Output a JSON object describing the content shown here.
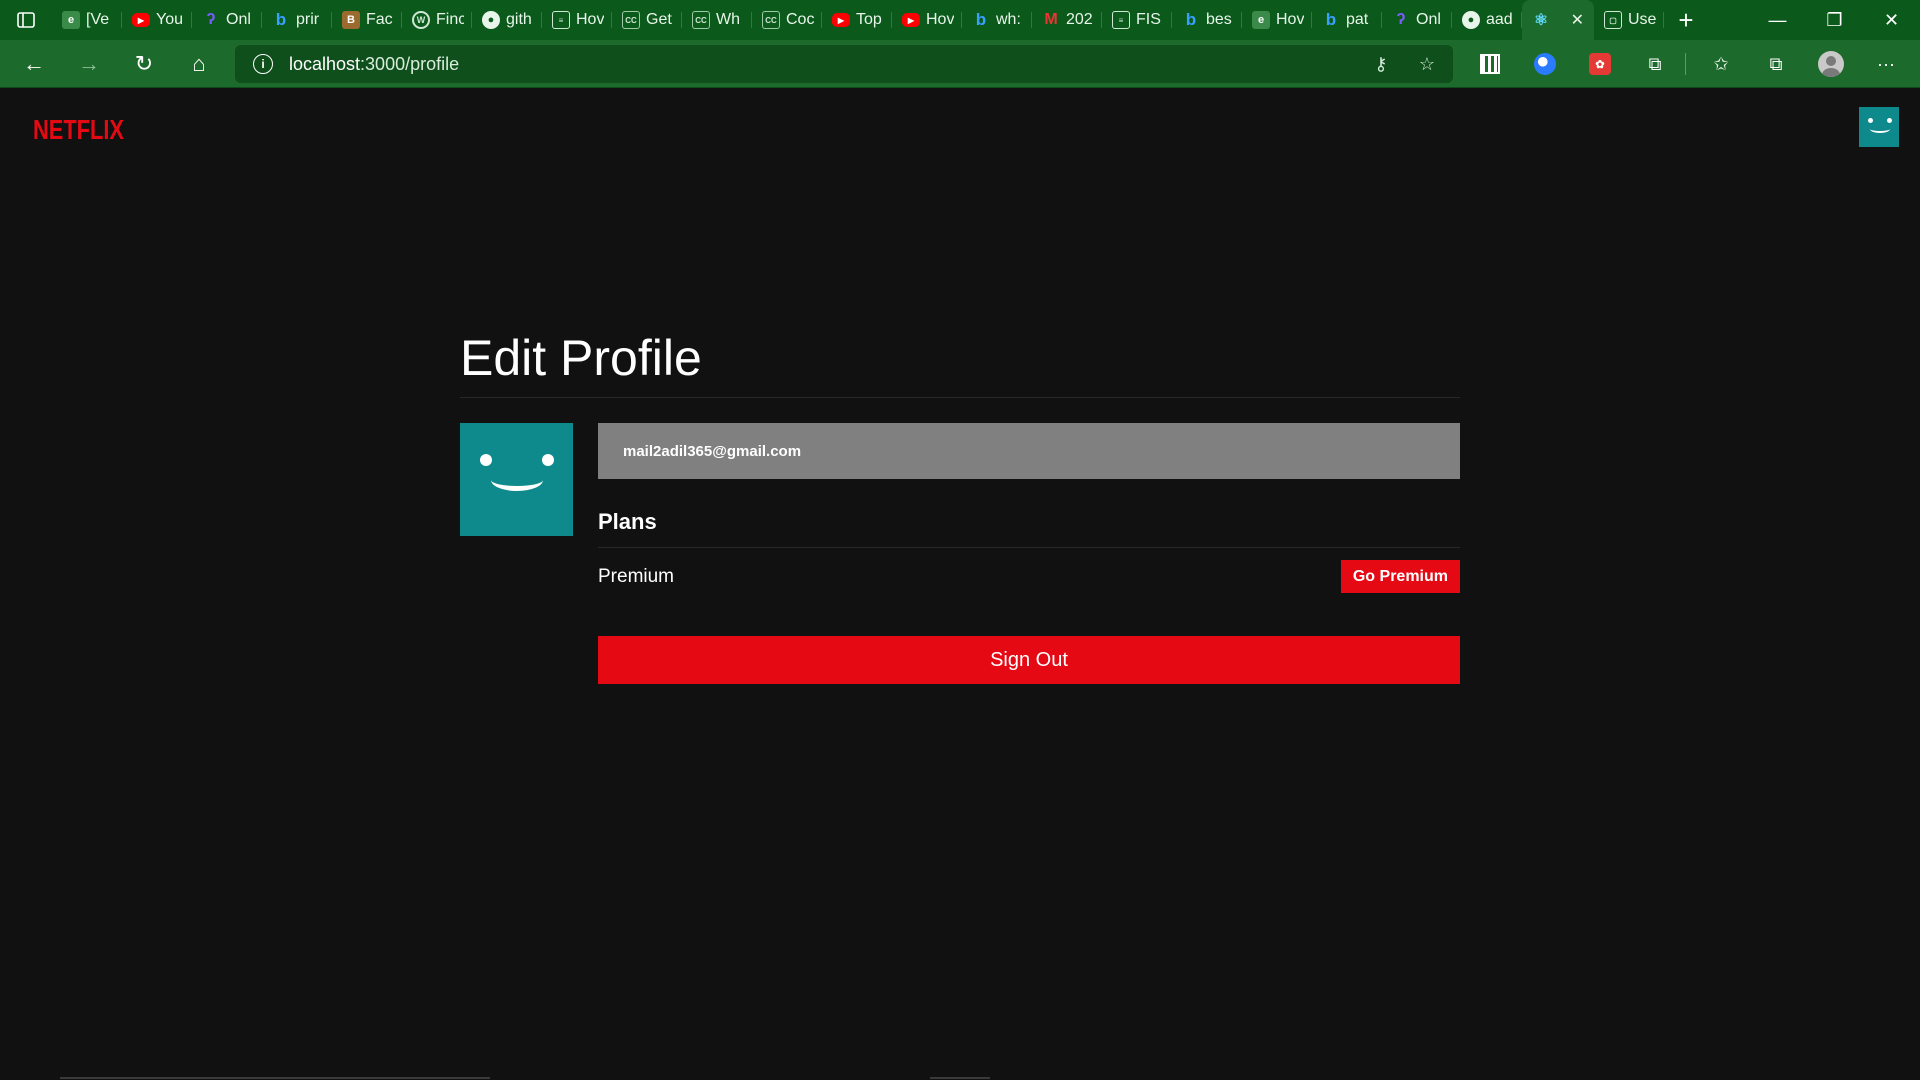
{
  "browser": {
    "tabs": [
      {
        "title": "[Ve",
        "icon": "generic-icon"
      },
      {
        "title": "You",
        "icon": "youtube-icon"
      },
      {
        "title": "Onl",
        "icon": "p-icon"
      },
      {
        "title": "prir",
        "icon": "bing-icon"
      },
      {
        "title": "Fac",
        "icon": "blogger-icon"
      },
      {
        "title": "Finc",
        "icon": "wordpress-icon"
      },
      {
        "title": "gith",
        "icon": "github-icon"
      },
      {
        "title": "Hov",
        "icon": "doc-icon"
      },
      {
        "title": "Get",
        "icon": "cc-icon"
      },
      {
        "title": "Wh",
        "icon": "cc-icon"
      },
      {
        "title": "Coc",
        "icon": "cc-icon"
      },
      {
        "title": "Top",
        "icon": "youtube-icon"
      },
      {
        "title": "Hov",
        "icon": "youtube-icon"
      },
      {
        "title": "wh:",
        "icon": "bing-icon"
      },
      {
        "title": "202",
        "icon": "gmail-icon"
      },
      {
        "title": "FIS",
        "icon": "doc-icon"
      },
      {
        "title": "bes",
        "icon": "bing-icon"
      },
      {
        "title": "Hov",
        "icon": "generic-icon"
      },
      {
        "title": "pat",
        "icon": "bing-icon"
      },
      {
        "title": "Onl",
        "icon": "p-icon"
      },
      {
        "title": "aad",
        "icon": "github-icon"
      }
    ],
    "active_tab": {
      "title": "",
      "icon": "react-icon",
      "close": "✕"
    },
    "last_tab": {
      "title": "Use",
      "icon": "page-icon"
    },
    "new_tab_label": "+",
    "url_host": "localhost",
    "url_path": ":3000/profile",
    "window_controls": {
      "minimize": "—",
      "restore": "❐",
      "close": "✕"
    }
  },
  "page": {
    "logo": "NETFLIX",
    "title": "Edit Profile",
    "email": "mail2adil365@gmail.com",
    "plans_heading": "Plans",
    "plan_name": "Premium",
    "plan_button": "Go Premium",
    "sign_out": "Sign Out",
    "colors": {
      "brand": "#e50914",
      "avatar": "#0f8a8c",
      "background": "#111111"
    }
  }
}
